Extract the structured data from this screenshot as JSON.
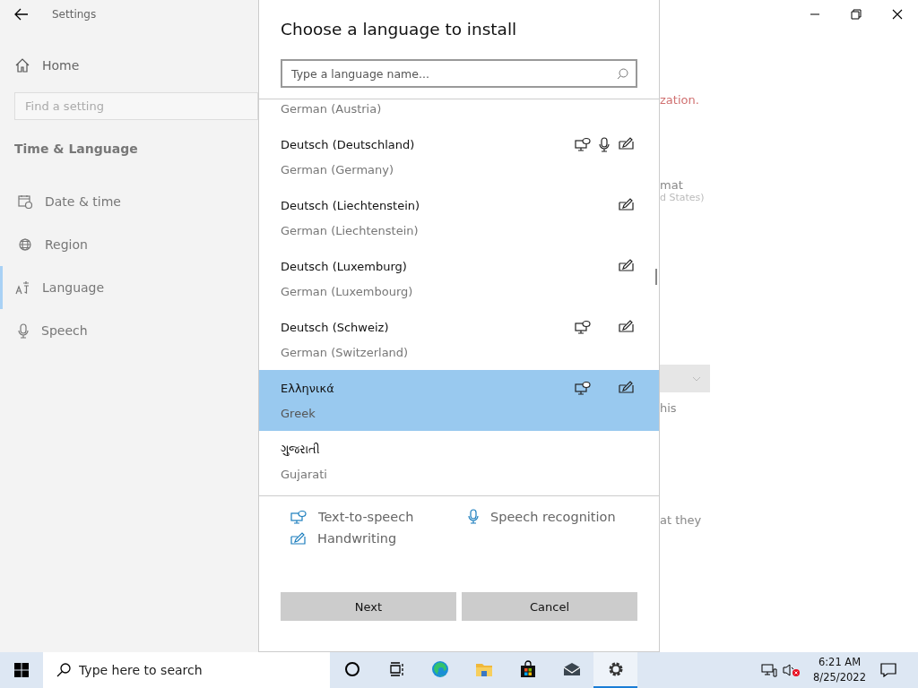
{
  "window": {
    "title": "Settings",
    "controls": [
      {
        "kind": "minimize"
      },
      {
        "kind": "restore"
      },
      {
        "kind": "close"
      }
    ]
  },
  "sidebar": {
    "home": "Home",
    "search": {
      "placeholder": "Find a setting"
    },
    "section": "Time & Language",
    "items": [
      {
        "label": "Date & time",
        "selected": false
      },
      {
        "label": "Region",
        "selected": false
      },
      {
        "label": "Language",
        "selected": true
      },
      {
        "label": "Speech",
        "selected": false
      }
    ]
  },
  "background_fragments": [
    {
      "kind": "warning",
      "text": "zation."
    },
    {
      "kind": "text",
      "text": "mat"
    },
    {
      "kind": "subtext",
      "text": "d States)"
    },
    {
      "kind": "dropdown"
    },
    {
      "kind": "text",
      "text": "his"
    },
    {
      "kind": "text",
      "text": "at they"
    }
  ],
  "dialog": {
    "title": "Choose a language to install",
    "search": {
      "placeholder": "Type a language name..."
    },
    "languages": [
      {
        "english": "German (Austria)",
        "tts": false,
        "speech": false,
        "handwriting": false,
        "selected": false
      },
      {
        "native": "Deutsch (Deutschland)",
        "english": "German (Germany)",
        "tts": true,
        "speech": true,
        "handwriting": true,
        "selected": false
      },
      {
        "native": "Deutsch (Liechtenstein)",
        "english": "German (Liechtenstein)",
        "tts": false,
        "speech": false,
        "handwriting": true,
        "selected": false
      },
      {
        "native": "Deutsch (Luxemburg)",
        "english": "German (Luxembourg)",
        "tts": false,
        "speech": false,
        "handwriting": true,
        "selected": false
      },
      {
        "native": "Deutsch (Schweiz)",
        "english": "German (Switzerland)",
        "tts": true,
        "speech": false,
        "handwriting": true,
        "selected": false
      },
      {
        "native": "Ελληνικά",
        "english": "Greek",
        "tts": true,
        "speech": false,
        "handwriting": true,
        "selected": true
      },
      {
        "native": "ગુજરાતી",
        "english": "Gujarati",
        "tts": false,
        "speech": false,
        "handwriting": false,
        "selected": false
      }
    ],
    "legend": [
      {
        "kind": "tts",
        "label": "Text-to-speech"
      },
      {
        "kind": "speech",
        "label": "Speech recognition"
      },
      {
        "kind": "handwriting",
        "label": "Handwriting"
      }
    ],
    "buttons": [
      "Next",
      "Cancel"
    ]
  },
  "taskbar": {
    "search": {
      "placeholder": "Type here to search"
    },
    "apps": [
      {
        "kind": "cortana",
        "active": false
      },
      {
        "kind": "taskview",
        "active": false
      },
      {
        "kind": "edge",
        "active": false
      },
      {
        "kind": "folder",
        "active": false
      },
      {
        "kind": "store",
        "active": false
      },
      {
        "kind": "mail",
        "active": false
      },
      {
        "kind": "settings",
        "active": true
      }
    ],
    "time": "6:21 AM",
    "date": "8/25/2022"
  }
}
